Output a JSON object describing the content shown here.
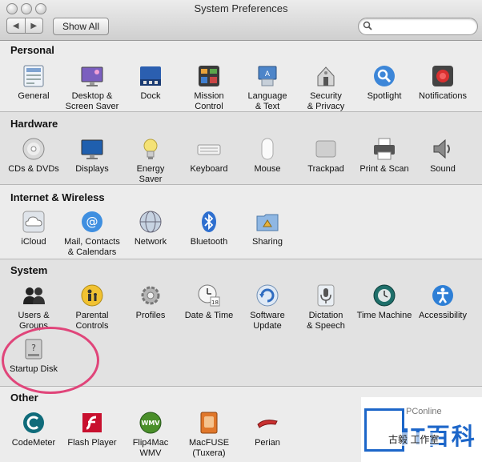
{
  "window": {
    "title": "System Preferences"
  },
  "toolbar": {
    "back_glyph": "◀",
    "forward_glyph": "▶",
    "show_all_label": "Show All",
    "search_placeholder": ""
  },
  "sections": {
    "personal": {
      "title": "Personal",
      "items": [
        {
          "label": "General",
          "icon": "general-icon"
        },
        {
          "label": "Desktop &\nScreen Saver",
          "icon": "desktop-icon"
        },
        {
          "label": "Dock",
          "icon": "dock-icon"
        },
        {
          "label": "Mission\nControl",
          "icon": "mission-control-icon"
        },
        {
          "label": "Language\n& Text",
          "icon": "language-icon"
        },
        {
          "label": "Security\n& Privacy",
          "icon": "security-icon"
        },
        {
          "label": "Spotlight",
          "icon": "spotlight-icon"
        },
        {
          "label": "Notifications",
          "icon": "notifications-icon"
        }
      ]
    },
    "hardware": {
      "title": "Hardware",
      "items": [
        {
          "label": "CDs & DVDs",
          "icon": "cd-icon"
        },
        {
          "label": "Displays",
          "icon": "display-icon"
        },
        {
          "label": "Energy\nSaver",
          "icon": "bulb-icon"
        },
        {
          "label": "Keyboard",
          "icon": "keyboard-icon"
        },
        {
          "label": "Mouse",
          "icon": "mouse-icon"
        },
        {
          "label": "Trackpad",
          "icon": "trackpad-icon"
        },
        {
          "label": "Print & Scan",
          "icon": "printer-icon"
        },
        {
          "label": "Sound",
          "icon": "speaker-icon"
        }
      ]
    },
    "internet": {
      "title": "Internet & Wireless",
      "items": [
        {
          "label": "iCloud",
          "icon": "cloud-icon"
        },
        {
          "label": "Mail, Contacts\n& Calendars",
          "icon": "at-icon"
        },
        {
          "label": "Network",
          "icon": "globe-icon"
        },
        {
          "label": "Bluetooth",
          "icon": "bluetooth-icon"
        },
        {
          "label": "Sharing",
          "icon": "sharing-folder-icon"
        }
      ]
    },
    "system": {
      "title": "System",
      "items": [
        {
          "label": "Users &\nGroups",
          "icon": "users-icon"
        },
        {
          "label": "Parental\nControls",
          "icon": "parental-icon"
        },
        {
          "label": "Profiles",
          "icon": "profiles-gear-icon"
        },
        {
          "label": "Date & Time",
          "icon": "clock-icon"
        },
        {
          "label": "Software\nUpdate",
          "icon": "update-icon"
        },
        {
          "label": "Dictation\n& Speech",
          "icon": "microphone-icon"
        },
        {
          "label": "Time Machine",
          "icon": "time-machine-icon"
        },
        {
          "label": "Accessibility",
          "icon": "accessibility-icon"
        },
        {
          "label": "Startup Disk",
          "icon": "disk-icon"
        }
      ]
    },
    "other": {
      "title": "Other",
      "items": [
        {
          "label": "CodeMeter",
          "icon": "codemeter-icon"
        },
        {
          "label": "Flash Player",
          "icon": "flash-icon"
        },
        {
          "label": "Flip4Mac\nWMV",
          "icon": "wmv-icon"
        },
        {
          "label": "MacFUSE\n(Tuxera)",
          "icon": "macfuse-icon"
        },
        {
          "label": "Perian",
          "icon": "perian-icon"
        }
      ]
    }
  },
  "watermark": {
    "brand": "PConline",
    "big_text": "IT百科",
    "account": "古毅 工作室"
  },
  "colors": {
    "annotation_circle": "#e0457a",
    "brand_blue": "#1c66c9"
  }
}
